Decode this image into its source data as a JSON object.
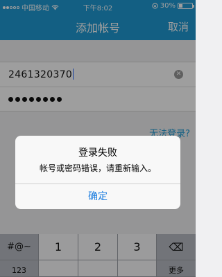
{
  "status_bar": {
    "carrier": "中国移动",
    "time": "下午8:02",
    "battery": "30%",
    "battery_level": 0.3
  },
  "nav": {
    "title": "添加帐号",
    "cancel_label": "取消"
  },
  "form": {
    "account_value": "2461320370",
    "password_masked_count": 8,
    "forgot_link": "无法登录?"
  },
  "alert": {
    "title": "登录失败",
    "message": "帐号或密码错误，请重新输入。",
    "button_label": "确定"
  },
  "keyboard": {
    "row1": [
      "#@~",
      "1",
      "2",
      "3",
      "⌫"
    ],
    "row2": [
      "123",
      "",
      "",
      "",
      "更多"
    ]
  }
}
